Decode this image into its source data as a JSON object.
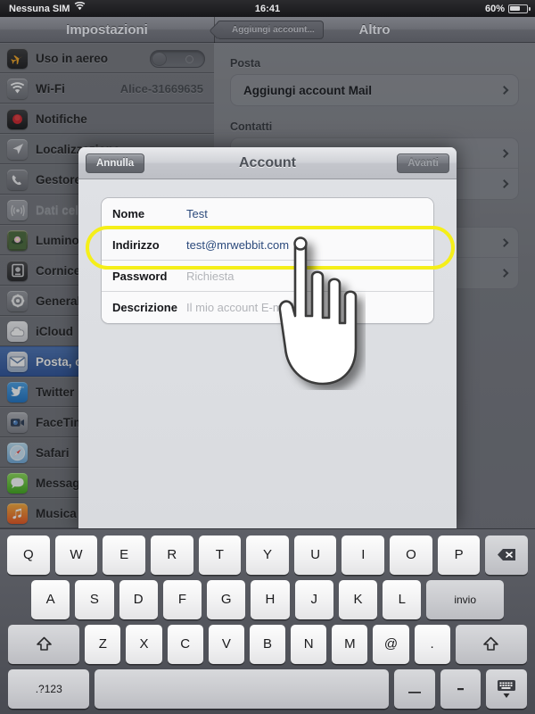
{
  "status_bar": {
    "carrier": "Nessuna SIM",
    "wifi_icon": "wifi-icon",
    "time": "16:41",
    "battery_percent": "60%"
  },
  "navbar": {
    "left_title": "Impostazioni",
    "back_button": "Aggiungi account...",
    "right_title": "Altro"
  },
  "sidebar": {
    "items": [
      {
        "label": "Uso in aereo",
        "icon": "airplane-icon",
        "control": "toggle",
        "toggle_on": false
      },
      {
        "label": "Wi-Fi",
        "icon": "wifi-icon",
        "value": "Alice-31669635"
      },
      {
        "label": "Notifiche",
        "icon": "notifications-icon"
      },
      {
        "label": "Localizzazione",
        "icon": "location-arrow-icon"
      },
      {
        "label": "Gestore",
        "icon": "phone-icon"
      },
      {
        "label": "Dati cellulare",
        "icon": "cellular-icon",
        "dimmed": true
      },
      {
        "label": "Luminosità e sfondo",
        "icon": "brightness-icon"
      },
      {
        "label": "Cornice",
        "icon": "picture-frame-icon"
      },
      {
        "label": "Generali",
        "icon": "gear-icon"
      },
      {
        "label": "iCloud",
        "icon": "cloud-icon"
      },
      {
        "label": "Posta, contatti, calendari",
        "icon": "mail-icon",
        "selected": true
      },
      {
        "label": "Twitter",
        "icon": "twitter-icon"
      },
      {
        "label": "FaceTime",
        "icon": "facetime-icon"
      },
      {
        "label": "Safari",
        "icon": "compass-icon"
      },
      {
        "label": "Messaggi",
        "icon": "messages-icon"
      },
      {
        "label": "Musica",
        "icon": "music-note-icon"
      }
    ]
  },
  "right_pane": {
    "groups": [
      {
        "header": "Posta",
        "rows": [
          {
            "label": "Aggiungi account Mail",
            "chevron": true
          }
        ]
      },
      {
        "header": "Contatti",
        "rows": [
          {
            "label": "",
            "chevron": true
          },
          {
            "label": "",
            "chevron": true
          }
        ]
      },
      {
        "header": "",
        "rows": [
          {
            "label": "",
            "chevron": true
          },
          {
            "label": "",
            "chevron": true
          }
        ]
      }
    ]
  },
  "modal": {
    "title": "Account",
    "cancel_label": "Annulla",
    "next_label": "Avanti",
    "fields": [
      {
        "label": "Nome",
        "value": "Test",
        "is_placeholder": false
      },
      {
        "label": "Indirizzo",
        "value": "test@mrwebbit.com",
        "is_placeholder": false
      },
      {
        "label": "Password",
        "value": "Richiesta",
        "is_placeholder": true
      },
      {
        "label": "Descrizione",
        "value": "Il mio account E-mail",
        "is_placeholder": true
      }
    ],
    "highlight_field": "Indirizzo",
    "highlight_color": "#f5ef19"
  },
  "keyboard": {
    "row1": [
      "Q",
      "W",
      "E",
      "R",
      "T",
      "Y",
      "U",
      "I",
      "O",
      "P"
    ],
    "backspace_icon": "backspace-icon",
    "row2": [
      "A",
      "S",
      "D",
      "F",
      "G",
      "H",
      "J",
      "K",
      "L"
    ],
    "return_label": "invio",
    "row3": [
      "Z",
      "X",
      "C",
      "V",
      "B",
      "N",
      "M",
      "@",
      "."
    ],
    "shift_icon": "shift-up-arrow-icon",
    "numbers_label": ".?123",
    "space_label": "",
    "underscore_label": "_",
    "hyphen_label": "-",
    "hide_keyboard_icon": "hide-keyboard-icon"
  }
}
